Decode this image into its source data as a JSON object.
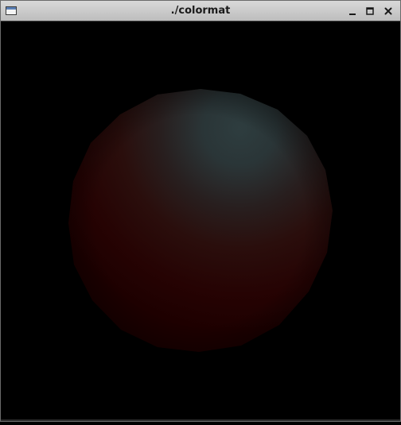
{
  "window": {
    "title": "./colormat",
    "icons": {
      "app": "window-app-icon",
      "minimize": "minimize-icon",
      "maximize": "maximize-icon",
      "close": "close-icon"
    }
  },
  "scene": {
    "object": "shaded-sphere",
    "background_color": "#000000",
    "colors": {
      "diffuse_dark": "#2a0000",
      "diffuse_mid": "#3a0a08",
      "specular_tint": "#2d3b3d"
    }
  }
}
